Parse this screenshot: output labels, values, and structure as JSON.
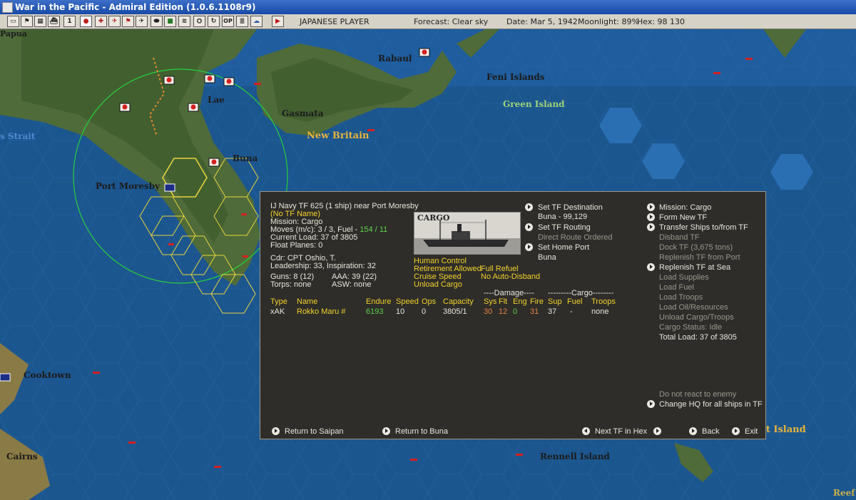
{
  "window": {
    "title": "War in the Pacific - Admiral Edition (1.0.6.1108r9)"
  },
  "toolbar": {
    "icons": [
      "save-icon",
      "flag-icon",
      "map-icon",
      "ship-icon",
      "info-icon",
      "japan-flag-icon",
      "base-icon",
      "air-icon",
      "flag2-icon",
      "aircraft-icon",
      "sub-icon",
      "land-icon",
      "fleet-icon",
      "ops-icon",
      "refresh-icon",
      "op-icon",
      "notes-icon",
      "weather-icon",
      "end-turn-icon"
    ],
    "labels": {
      "info": "1",
      "op": "OP"
    },
    "player": "JAPANESE PLAYER",
    "forecast": "Forecast: Clear sky",
    "date": "Date: Mar 5, 1942",
    "moonlight": "Moonlight: 89%",
    "hex": "Hex: 98 130"
  },
  "map": {
    "labels": {
      "papua": "Papua",
      "rabaul": "Rabaul",
      "feni": "Feni Islands",
      "lae": "Lae",
      "gasmata": "Gasmata",
      "green_island": "Green Island",
      "new_britain": "New Britain",
      "strait": "s Strait",
      "buna": "Buna",
      "port_moresby": "Port Moresby",
      "cooktown": "Cooktown",
      "cairns": "Cairns",
      "rennell": "Rennell Island",
      "reef": "Reef",
      "island_right": "rt Island"
    }
  },
  "tf": {
    "header": "IJ Navy TF 625 (1 ship)  near Port Moresby",
    "name": "(No TF Name)",
    "mission": "Mission: Cargo",
    "moves": "Moves (m/c): 3 / 3, Fuel - ",
    "fuel_value": "154 / 11",
    "current_load": "Current Load: 37 of 3805",
    "float_planes": "Float Planes: 0",
    "cdr": "Cdr: CPT  Oshio, T.",
    "leadership": "Leadership: 33, Inspiration: 32",
    "guns": "Guns: 8 (12)",
    "aaa": "AAA: 39 (22)",
    "torps": "Torps: none",
    "asw": "ASW: none",
    "picture_caption": "CARGO",
    "flags": {
      "human_control": "Human Control",
      "retirement": "Retirement Allowed",
      "full_refuel": "Full Refuel",
      "cruise_speed": "Cruise Speed",
      "no_auto_disband": "No Auto-Disband",
      "unload_cargo": "Unload Cargo"
    }
  },
  "commands_mid": {
    "set_destination": "Set TF Destination",
    "destination_value": "Buna - 99,129",
    "set_routing": "Set TF Routing",
    "routing_value": "Direct Route Ordered",
    "set_home_port": "Set Home Port",
    "home_port_value": "Buna"
  },
  "commands_right": {
    "mission": "Mission: Cargo",
    "form_new_tf": "Form New TF",
    "transfer_ships": "Transfer Ships to/from TF",
    "disband_tf": "Disband TF",
    "dock_tf": "Dock TF (3,675 tons)",
    "replenish_port": "Replenish TF from Port",
    "replenish_sea": "Replenish TF at Sea",
    "load_supplies": "Load Supplies",
    "load_fuel": "Load Fuel",
    "load_troops": "Load Troops",
    "load_oil": "Load Oil/Resources",
    "unload": "Unload Cargo/Troops",
    "cargo_status": "Cargo Status: Idle",
    "total_load": "Total Load: 37 of 3805",
    "no_react": "Do not react to enemy",
    "change_hq": "Change HQ for all ships in TF"
  },
  "ship_table": {
    "damage_group": "----Damage----",
    "cargo_group": "---------Cargo--------",
    "headers": {
      "type": "Type",
      "name": "Name",
      "endure": "Endure",
      "speed": "Speed",
      "ops": "Ops",
      "capacity": "Capacity",
      "sys": "Sys",
      "flt": "Flt",
      "eng": "Eng",
      "fire": "Fire",
      "sup": "Sup",
      "fuel": "Fuel",
      "troops": "Troops"
    },
    "rows": [
      {
        "type": "xAK",
        "name": "Rokko Maru #",
        "endure": "6193",
        "speed": "10",
        "ops": "0",
        "capacity": "3805/1",
        "sys": "30",
        "flt": "12",
        "eng": "0",
        "fire": "31",
        "sup": "37",
        "fuel": "-",
        "troops": "none"
      }
    ]
  },
  "footer": {
    "return_saipan": "Return to Saipan",
    "return_buna": "Return to Buna",
    "next_tf": "Next TF in Hex",
    "back": "Back",
    "exit": "Exit"
  }
}
